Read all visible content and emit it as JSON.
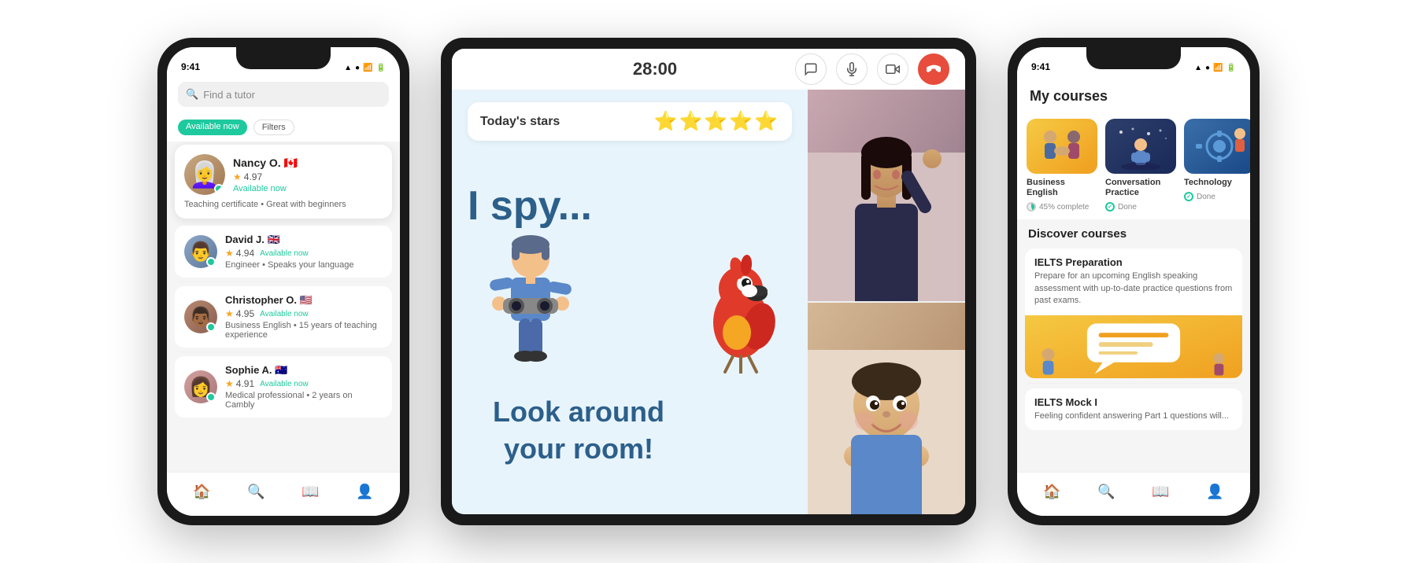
{
  "scene": {
    "bg": "#ffffff"
  },
  "phone1": {
    "status_time": "9:41",
    "status_icons": "▲ ◉ 📶",
    "search_placeholder": "Find a tutor",
    "badge_available": "Available now",
    "badge_filters": "Filters",
    "tutors": [
      {
        "name": "Nancy O.",
        "flag": "🇨🇦",
        "rating": "4.97",
        "status": "Available now",
        "tags": "Teaching certificate • Great with beginners",
        "featured": true,
        "avatar_style": "avatar-lady"
      },
      {
        "name": "David J.",
        "flag": "🇬🇧",
        "rating": "4.94",
        "status": "Available now",
        "tags": "Engineer • Speaks your language",
        "avatar_style": "avatar-man1"
      },
      {
        "name": "Christopher O.",
        "flag": "🇺🇸",
        "rating": "4.95",
        "status": "Available now",
        "tags": "Business English • 15 years of teaching experience",
        "avatar_style": "avatar-man2"
      },
      {
        "name": "Sophie A.",
        "flag": "🇦🇺",
        "rating": "4.91",
        "status": "Available now",
        "tags": "Medical professional • 2 years on Cambly",
        "avatar_style": "avatar-lady2"
      }
    ],
    "nav_items": [
      "🏠",
      "🔍",
      "📖",
      "👤"
    ]
  },
  "tablet": {
    "timer": "28:00",
    "controls": [
      "💬",
      "🎤",
      "📷",
      "📞"
    ],
    "stars_label": "Today's stars",
    "stars": "⭐⭐⭐⭐⭐",
    "spy_title": "I spy...",
    "look_text": "Look around\nyour room!",
    "parrot_emoji": "🦜"
  },
  "phone2": {
    "status_time": "9:41",
    "my_courses_title": "My courses",
    "courses": [
      {
        "name": "Business English",
        "progress_label": "45% complete",
        "thumb_style": "course-thumb-be",
        "emoji": "🤝",
        "progress_type": "partial"
      },
      {
        "name": "Conversation Practice",
        "progress_label": "Done",
        "thumb_style": "course-thumb-cp",
        "emoji": "💬",
        "progress_type": "done"
      },
      {
        "name": "Technology",
        "progress_label": "Done",
        "thumb_style": "course-thumb-tech",
        "emoji": "⚙️",
        "progress_type": "done"
      }
    ],
    "discover_title": "Discover courses",
    "discover_cards": [
      {
        "title": "IELTS Preparation",
        "desc": "Prepare for an upcoming English speaking assessment with up-to-date practice questions from past exams."
      },
      {
        "title": "IELTS Mock I",
        "desc": "Feeling confident answering Part 1 questions will..."
      }
    ],
    "nav_items": [
      "🏠",
      "🔍",
      "📖",
      "👤"
    ]
  }
}
